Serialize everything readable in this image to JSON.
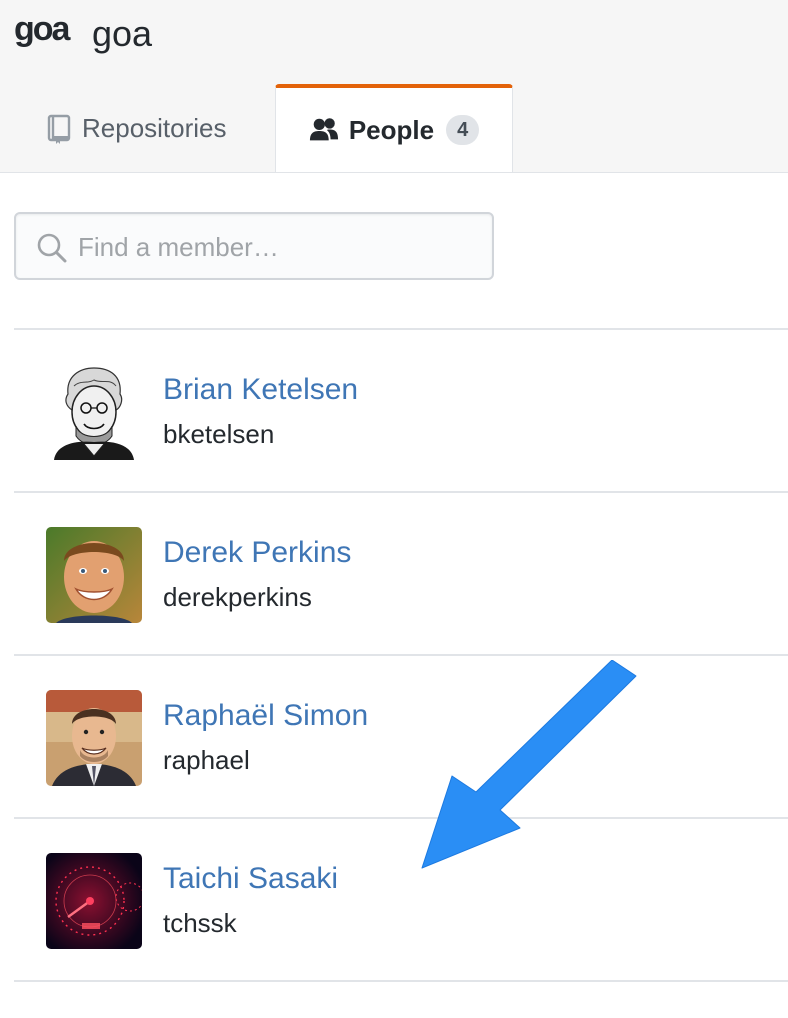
{
  "org": {
    "logo_text": "goa",
    "name": "goa"
  },
  "tabs": [
    {
      "label": "Repositories",
      "icon": "repo-icon",
      "selected": false
    },
    {
      "label": "People",
      "icon": "people-icon",
      "selected": true,
      "count": "4"
    }
  ],
  "search": {
    "placeholder": "Find a member…",
    "value": ""
  },
  "members": [
    {
      "name": "Brian Ketelsen",
      "login": "bketelsen",
      "avatar": "sketch-portrait-avatar"
    },
    {
      "name": "Derek Perkins",
      "login": "derekperkins",
      "avatar": "smiling-man-photo-avatar"
    },
    {
      "name": "Raphaël Simon",
      "login": "raphael",
      "avatar": "man-in-suit-photo-avatar"
    },
    {
      "name": "Taichi Sasaki",
      "login": "tchssk",
      "avatar": "speedometer-photo-avatar"
    }
  ],
  "annotation": {
    "color": "#2a8ef5",
    "icon": "pointing-arrow"
  },
  "colors": {
    "accent": "#e36209",
    "link": "#3f76b5"
  }
}
